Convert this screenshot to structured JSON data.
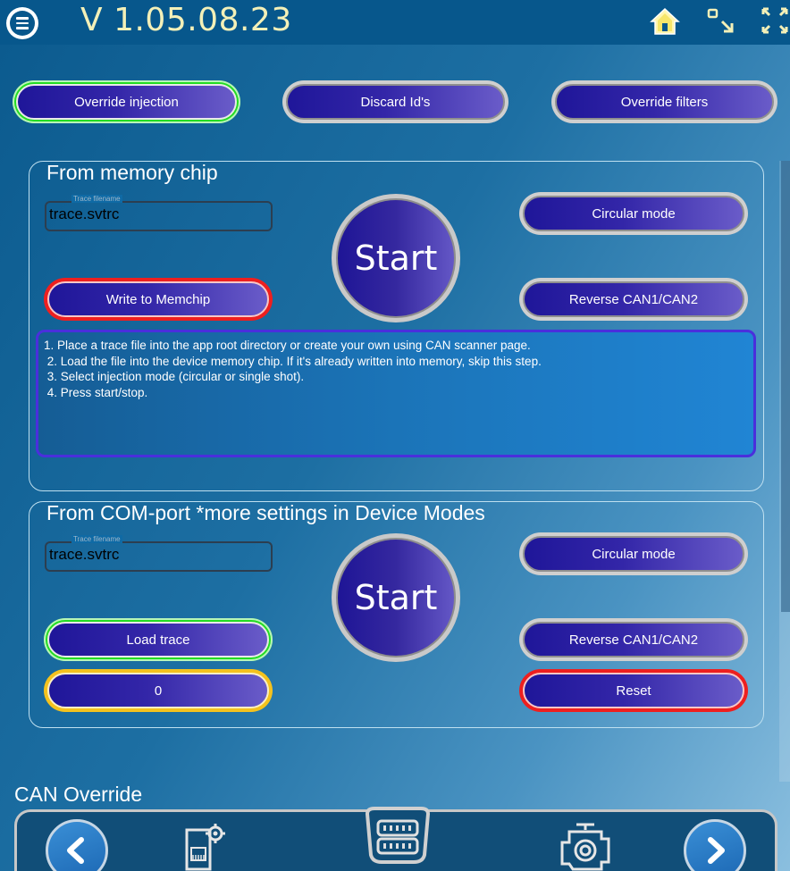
{
  "header": {
    "version": "V 1.05.08.23",
    "menu_icon": "menu-icon",
    "home_icon": "home-icon",
    "collapse_icon": "collapse-icon",
    "fullscreen_icon": "fullscreen-icon"
  },
  "top_buttons": {
    "override_injection": "Override injection",
    "discard_ids": "Discard Id's",
    "override_filters": "Override filters"
  },
  "memory_section": {
    "title": "From memory chip",
    "trace_label": "Trace filename",
    "trace_value": "trace.svtrc",
    "start_label": "Start",
    "circular_mode": "Circular mode",
    "reverse_can": "Reverse CAN1/CAN2",
    "write_memchip": "Write to Memchip",
    "instructions": "1. Place a trace file into the app root directory or create your own using CAN scanner page.\n 2. Load the file into the device memory chip. If it's already written into memory, skip this step.\n 3. Select injection mode (circular or single shot).\n 4. Press start/stop."
  },
  "com_section": {
    "title": "From COM-port *more settings in Device Modes",
    "trace_label": "Trace filename",
    "trace_value": "trace.svtrc",
    "start_label": "Start",
    "circular_mode": "Circular mode",
    "reverse_can": "Reverse CAN1/CAN2",
    "load_trace": "Load trace",
    "counter": "0",
    "reset": "Reset"
  },
  "footer": {
    "section_title": "CAN Override",
    "nav_icons": [
      "chevron-left-icon",
      "memory-card-settings-icon",
      "obd-connector-icon",
      "engine-icon",
      "chevron-right-icon"
    ]
  },
  "colors": {
    "header_bg": "#07578c",
    "version_text": "#f3f0b8",
    "button_gradient_start": "#1f1699",
    "button_gradient_end": "#6a5cc9",
    "active_green": "#22dd22",
    "alert_red": "#ee1f1f",
    "warning_yellow": "#f4c21e",
    "instructions_border": "#4a2fdc"
  }
}
